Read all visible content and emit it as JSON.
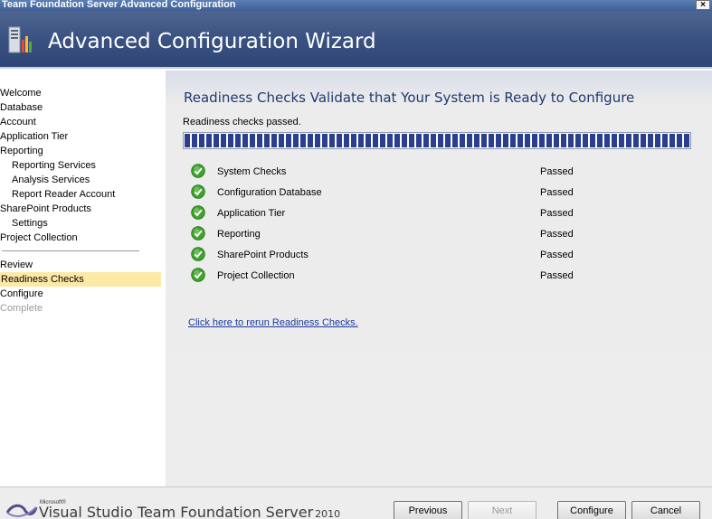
{
  "window": {
    "title": "Team Foundation Server Advanced Configuration",
    "close_glyph": "×"
  },
  "banner": {
    "title": "Advanced Configuration Wizard",
    "logo_icon": "tfs-server-icon"
  },
  "nav": {
    "items": [
      {
        "label": "Welcome",
        "level": 0,
        "state": "normal"
      },
      {
        "label": "Database",
        "level": 0,
        "state": "normal"
      },
      {
        "label": "Account",
        "level": 0,
        "state": "normal"
      },
      {
        "label": "Application Tier",
        "level": 0,
        "state": "normal"
      },
      {
        "label": "Reporting",
        "level": 0,
        "state": "normal"
      },
      {
        "label": "Reporting Services",
        "level": 1,
        "state": "normal"
      },
      {
        "label": "Analysis Services",
        "level": 1,
        "state": "normal"
      },
      {
        "label": "Report Reader Account",
        "level": 1,
        "state": "normal"
      },
      {
        "label": "SharePoint Products",
        "level": 0,
        "state": "normal"
      },
      {
        "label": "Settings",
        "level": 1,
        "state": "normal"
      },
      {
        "label": "Project Collection",
        "level": 0,
        "state": "normal"
      },
      {
        "label": "Review",
        "level": 0,
        "state": "normal"
      },
      {
        "label": "Readiness Checks",
        "level": 0,
        "state": "selected"
      },
      {
        "label": "Configure",
        "level": 0,
        "state": "normal"
      },
      {
        "label": "Complete",
        "level": 0,
        "state": "disabled"
      }
    ]
  },
  "main": {
    "title": "Readiness Checks Validate that Your System is Ready to Configure",
    "status": "Readiness checks passed.",
    "progress_fraction": 1.0,
    "checks": [
      {
        "name": "System Checks",
        "status": "Passed"
      },
      {
        "name": "Configuration Database",
        "status": "Passed"
      },
      {
        "name": "Application Tier",
        "status": "Passed"
      },
      {
        "name": "Reporting",
        "status": "Passed"
      },
      {
        "name": "SharePoint Products",
        "status": "Passed"
      },
      {
        "name": "Project Collection",
        "status": "Passed"
      }
    ],
    "rerun_link": "Click here to rerun Readiness Checks."
  },
  "footer": {
    "product_small": "Microsoft®",
    "product_name": "Visual Studio Team Foundation Server",
    "product_year": "2010",
    "buttons": {
      "previous": "Previous",
      "next": "Next",
      "configure": "Configure",
      "cancel": "Cancel"
    }
  },
  "colors": {
    "banner": "#3a5282",
    "selected_nav": "#fde9a6",
    "progress": "#2b3f8e",
    "check_green": "#3fa52a",
    "link": "#1a3a9c"
  }
}
